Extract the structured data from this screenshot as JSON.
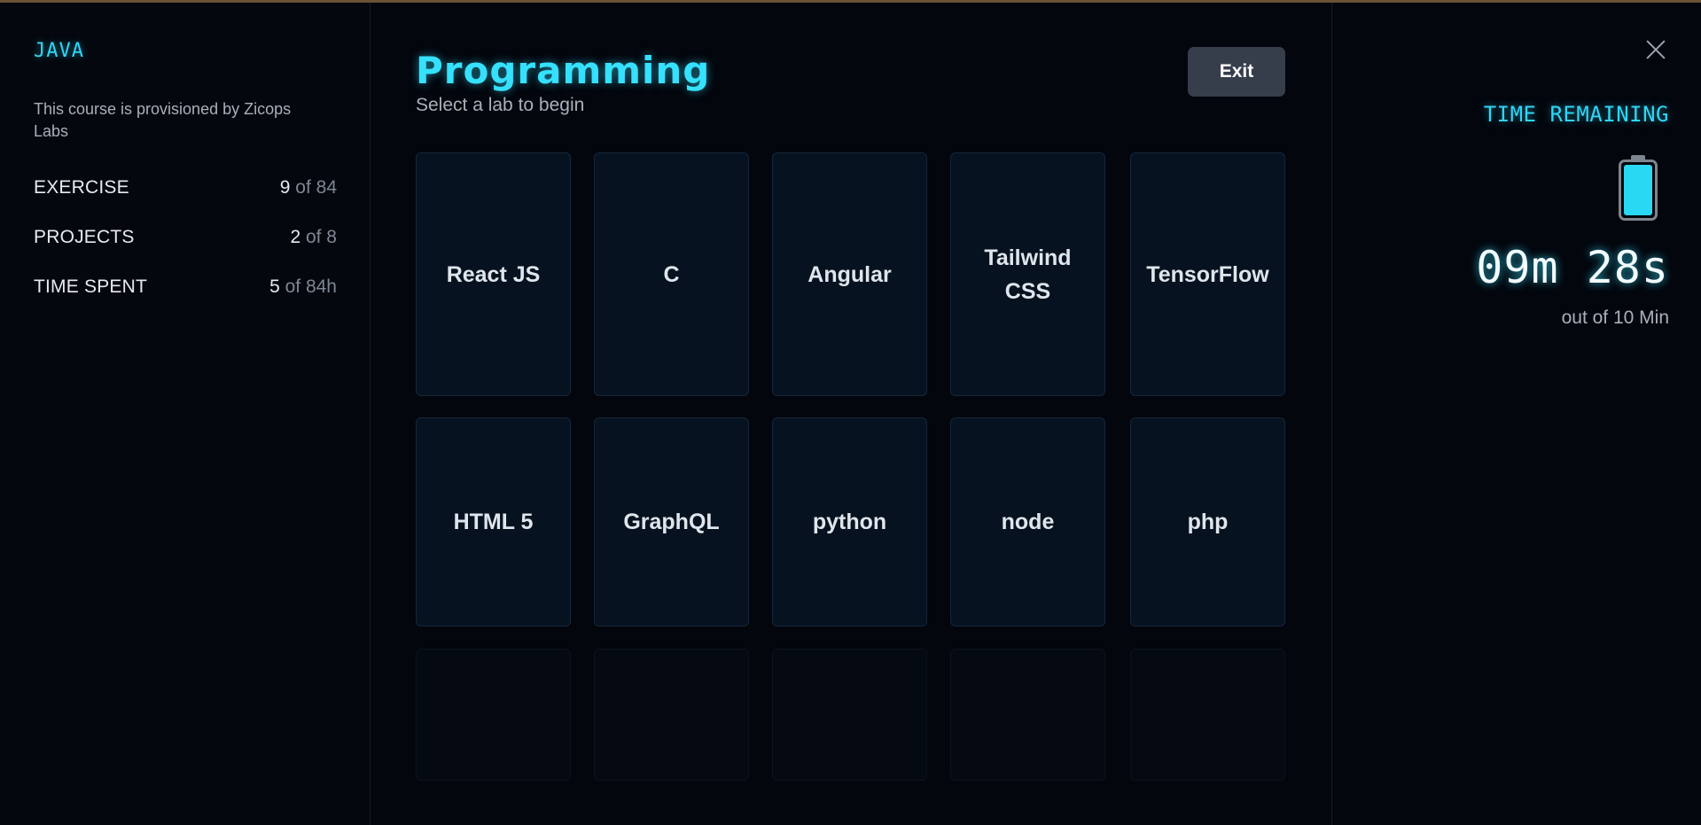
{
  "sidebar": {
    "course_title": "JAVA",
    "description": "This course is provisioned by Zicops Labs",
    "stats": [
      {
        "label": "EXERCISE",
        "current": "9",
        "total": " of 84"
      },
      {
        "label": "PROJECTS",
        "current": "2",
        "total": " of 8"
      },
      {
        "label": "TIME SPENT",
        "current": "5",
        "total": " of 84h"
      }
    ]
  },
  "main": {
    "title": "Programming",
    "subtitle": "Select a lab to begin",
    "exit_label": "Exit",
    "labs": [
      {
        "label": "React JS"
      },
      {
        "label": "C"
      },
      {
        "label": "Angular"
      },
      {
        "label": "Tailwind CSS"
      },
      {
        "label": "TensorFlow"
      },
      {
        "label": "HTML 5"
      },
      {
        "label": "GraphQL"
      },
      {
        "label": "python"
      },
      {
        "label": "node"
      },
      {
        "label": "php"
      }
    ]
  },
  "timer": {
    "label": "TIME REMAINING",
    "value": "09m 28s",
    "subtitle": "out of 10 Min",
    "battery_icon": "battery-icon",
    "battery_level": 1.0,
    "accent_color": "#2fd6f5"
  }
}
